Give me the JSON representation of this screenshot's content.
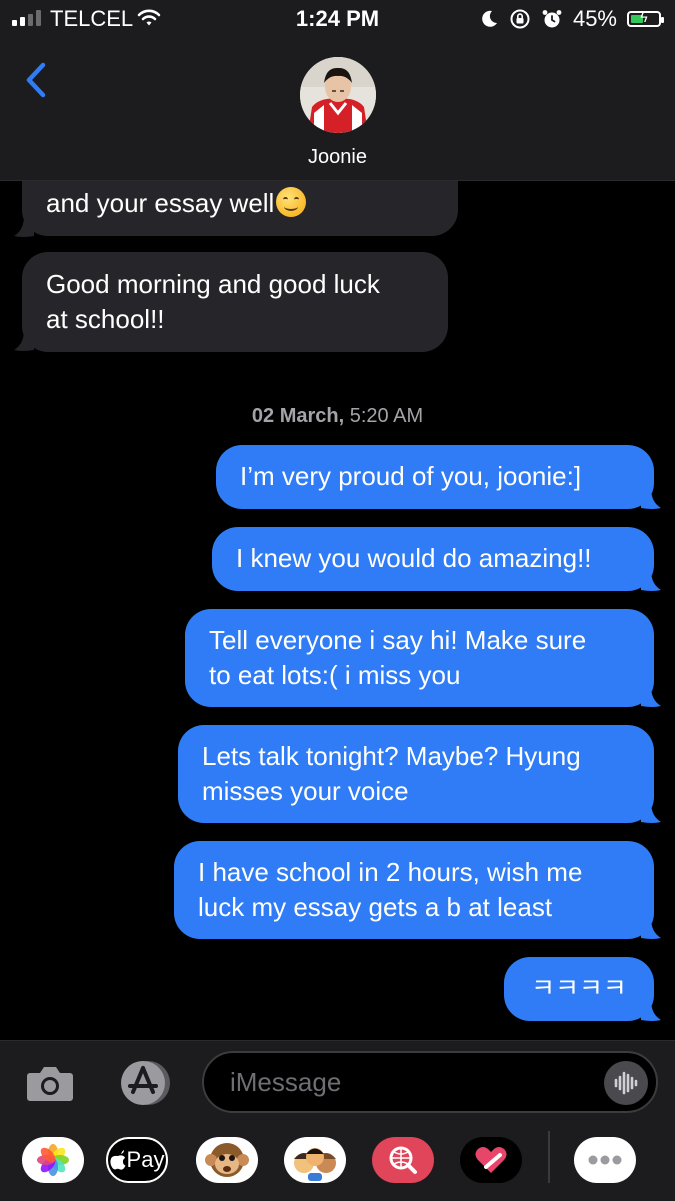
{
  "status_bar": {
    "carrier": "TELCEL",
    "time": "1:24 PM",
    "battery_percent": "45%",
    "battery_level": 0.45,
    "icons": [
      "signal-icon",
      "wifi-icon",
      "moon-icon",
      "orientation-lock-icon",
      "alarm-icon",
      "battery-charging-icon"
    ]
  },
  "header": {
    "contact_name": "Joonie",
    "back_icon": "chevron-left-icon"
  },
  "conversation": {
    "incoming": [
      {
        "text": "and your essay well",
        "emoji": "smiling-face-emoji"
      },
      {
        "line1": "Good morning and good luck",
        "line2": "at school!!"
      }
    ],
    "timestamp": {
      "date": "02 March,",
      "time": "5:20 AM"
    },
    "outgoing": [
      {
        "text": "I’m very proud of you, joonie:]"
      },
      {
        "text": "I knew you would do amazing!!"
      },
      {
        "line1": "Tell everyone i say hi! Make sure",
        "line2": "to eat lots:( i miss you"
      },
      {
        "line1": "Lets talk tonight? Maybe? Hyung",
        "line2": "misses your voice"
      },
      {
        "line1": "I have school in 2 hours, wish me",
        "line2": "luck my essay gets a b at least"
      },
      {
        "text": "ㅋㅋㅋㅋ"
      }
    ]
  },
  "composer": {
    "placeholder": "iMessage",
    "camera_icon": "camera-icon",
    "appstore_icon": "app-store-icon",
    "voice_icon": "waveform-icon"
  },
  "app_tray": {
    "apple_pay_label": "Pay",
    "apps": [
      "photos-icon",
      "apple-pay-icon",
      "monkey-memoji-icon",
      "memoji-stickers-icon",
      "web-search-icon",
      "digital-touch-icon",
      "more-icon"
    ]
  },
  "colors": {
    "outgoing_bubble": "#2f7cf6",
    "incoming_bubble": "#26262a",
    "background": "#000000",
    "accent": "#2f7cf6"
  }
}
